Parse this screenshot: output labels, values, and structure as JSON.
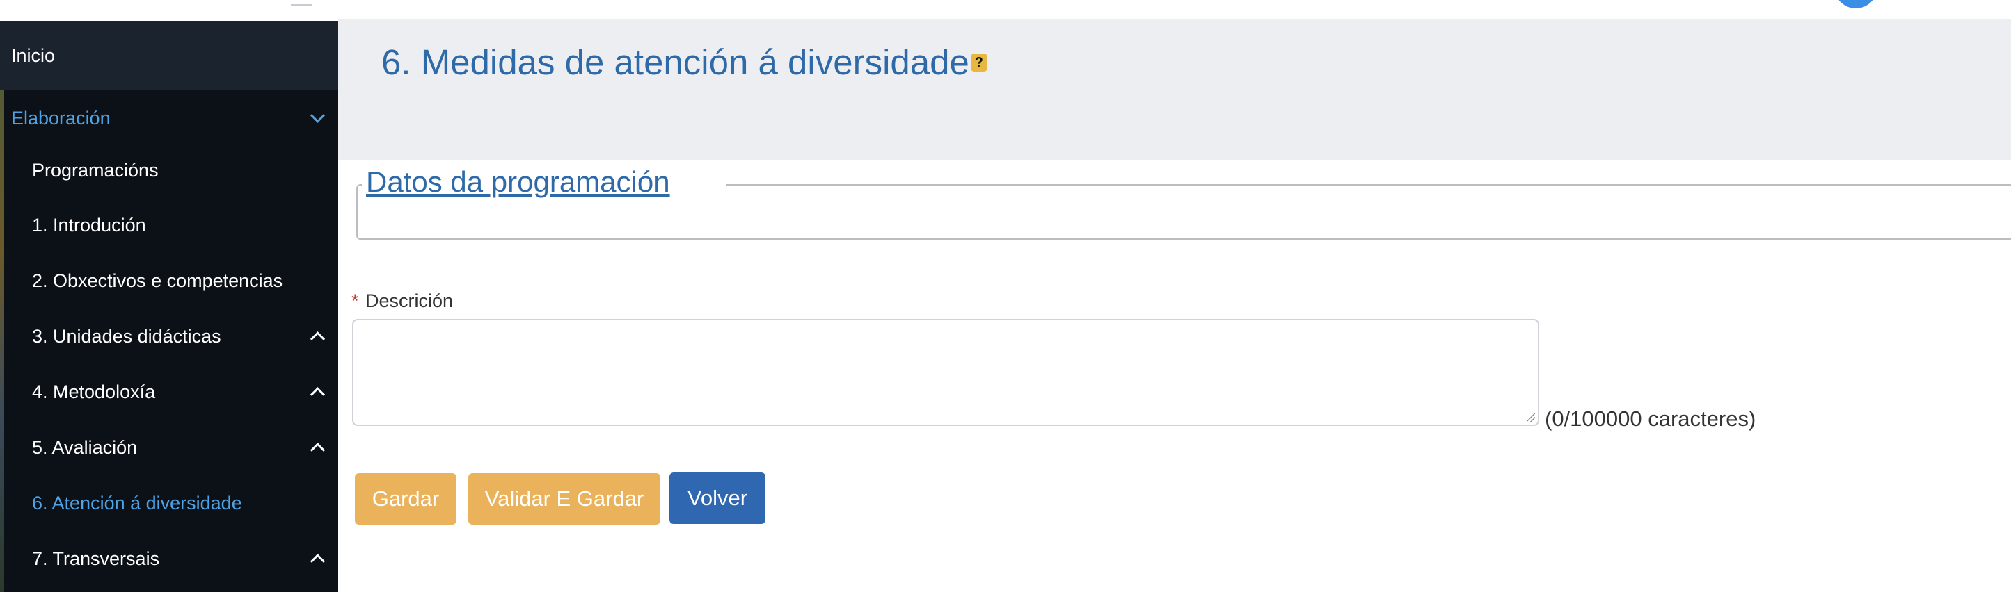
{
  "sidebar": {
    "items": [
      {
        "label": "Inicio"
      },
      {
        "label": "Elaboración"
      },
      {
        "label": "Programacións"
      },
      {
        "label": "1. Introdución"
      },
      {
        "label": "2. Obxectivos e competencias"
      },
      {
        "label": "3. Unidades didácticas"
      },
      {
        "label": "4. Metodoloxía"
      },
      {
        "label": "5. Avaliación"
      },
      {
        "label": "6. Atención á diversidade"
      },
      {
        "label": "7. Transversais"
      }
    ],
    "active_color": "#4ea3e6"
  },
  "main": {
    "title": "6. Medidas de atención á diversidade",
    "help_icon_glyph": "?",
    "fieldset_legend": "Datos da programación",
    "form": {
      "required_mark": "*",
      "description_label": "Descrición",
      "description_value": "",
      "char_counter": "(0/100000 caracteres)"
    },
    "buttons": {
      "save": "Gardar",
      "validate_save": "Validar E Gardar",
      "back": "Volver"
    }
  },
  "colors": {
    "title": "#2f6aa8",
    "warning_button": "#e9b25b",
    "primary_button": "#2f68b0",
    "sidebar_bg": "#0c1117"
  }
}
